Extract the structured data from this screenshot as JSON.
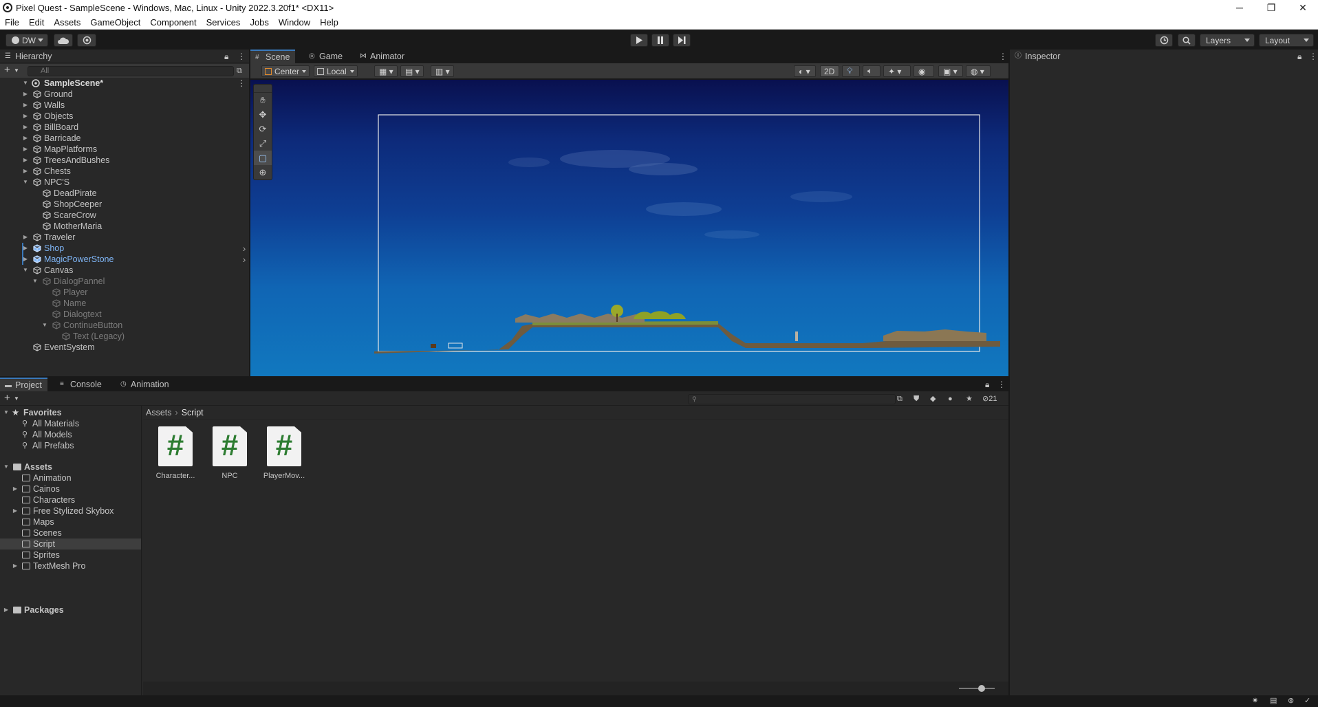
{
  "window": {
    "title": "Pixel Quest - SampleScene - Windows, Mac, Linux - Unity 2022.3.20f1* <DX11>",
    "controls": [
      "─",
      "❐",
      "✕"
    ]
  },
  "menu": [
    "File",
    "Edit",
    "Assets",
    "GameObject",
    "Component",
    "Services",
    "Jobs",
    "Window",
    "Help"
  ],
  "toolbar": {
    "account": "DW",
    "layers": "Layers",
    "layout": "Layout"
  },
  "hierarchy": {
    "tab": "Hierarchy",
    "search_placeholder": "All",
    "scene": "SampleScene*",
    "items": [
      {
        "label": "Ground"
      },
      {
        "label": "Walls"
      },
      {
        "label": "Objects"
      },
      {
        "label": "BillBoard"
      },
      {
        "label": "Barricade"
      },
      {
        "label": "MapPlatforms"
      },
      {
        "label": "TreesAndBushes"
      },
      {
        "label": "Chests"
      },
      {
        "label": "NPC'S"
      },
      {
        "label": "DeadPirate"
      },
      {
        "label": "ShopCeeper"
      },
      {
        "label": "ScareCrow"
      },
      {
        "label": "MotherMaria"
      },
      {
        "label": "Traveler"
      },
      {
        "label": "Shop"
      },
      {
        "label": "MagicPowerStone"
      },
      {
        "label": "Canvas"
      },
      {
        "label": "DialogPannel"
      },
      {
        "label": "Player"
      },
      {
        "label": "Name"
      },
      {
        "label": "Dialogtext"
      },
      {
        "label": "ContinueButton"
      },
      {
        "label": "Text (Legacy)"
      },
      {
        "label": "EventSystem"
      }
    ]
  },
  "scene_view": {
    "tabs": [
      "Scene",
      "Game",
      "Animator"
    ],
    "pivot": "Center",
    "space": "Local",
    "mode_2d": "2D"
  },
  "inspector": {
    "tab": "Inspector"
  },
  "project": {
    "tabs": [
      "Project",
      "Console",
      "Animation"
    ],
    "favorites": {
      "title": "Favorites",
      "items": [
        "All Materials",
        "All Models",
        "All Prefabs"
      ]
    },
    "assets": {
      "title": "Assets",
      "folders": [
        "Animation",
        "Cainos",
        "Characters",
        "Free Stylized Skybox",
        "Maps",
        "Scenes",
        "Script",
        "Sprites",
        "TextMesh Pro"
      ]
    },
    "packages": "Packages",
    "breadcrumb": [
      "Assets",
      "Script"
    ],
    "files": [
      "Character...",
      "NPC",
      "PlayerMov..."
    ],
    "hidden_count": "21"
  },
  "colors": {
    "accent": "#3a79bb",
    "prefab": "#7fb5f5",
    "background": "#282828"
  }
}
